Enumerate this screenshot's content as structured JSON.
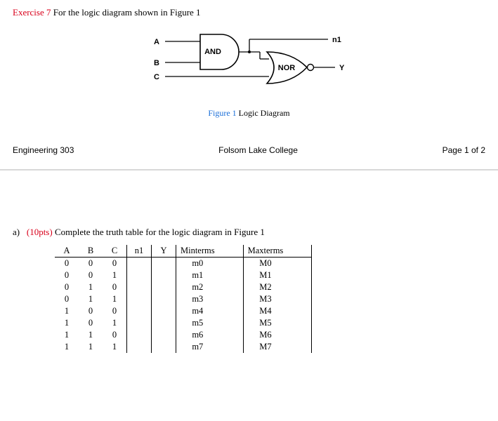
{
  "exercise": {
    "label": "Exercise 7",
    "prompt": "For the logic diagram shown in Figure 1"
  },
  "diagram": {
    "inputs": {
      "A": "A",
      "B": "B",
      "C": "C"
    },
    "gates": {
      "and": "AND",
      "nor": "NOR"
    },
    "signals": {
      "n1": "n1",
      "Y": "Y"
    },
    "caption_label": "Figure 1",
    "caption_text": "Logic Diagram"
  },
  "footer": {
    "left": "Engineering 303",
    "center": "Folsom Lake College",
    "right": "Page 1 of 2"
  },
  "partA": {
    "id": "a)",
    "pts": "(10pts)",
    "text": "Complete the truth table for the logic diagram in Figure 1"
  },
  "truth": {
    "headers": [
      "A",
      "B",
      "C",
      "n1",
      "Y",
      "Minterms",
      "",
      "Maxterms",
      ""
    ],
    "rows": [
      {
        "A": "0",
        "B": "0",
        "C": "0",
        "n1": "",
        "Y": "",
        "min": "m0",
        "minv": "",
        "max": "M0",
        "maxv": ""
      },
      {
        "A": "0",
        "B": "0",
        "C": "1",
        "n1": "",
        "Y": "",
        "min": "m1",
        "minv": "",
        "max": "M1",
        "maxv": ""
      },
      {
        "A": "0",
        "B": "1",
        "C": "0",
        "n1": "",
        "Y": "",
        "min": "m2",
        "minv": "",
        "max": "M2",
        "maxv": ""
      },
      {
        "A": "0",
        "B": "1",
        "C": "1",
        "n1": "",
        "Y": "",
        "min": "m3",
        "minv": "",
        "max": "M3",
        "maxv": ""
      },
      {
        "A": "1",
        "B": "0",
        "C": "0",
        "n1": "",
        "Y": "",
        "min": "m4",
        "minv": "",
        "max": "M4",
        "maxv": ""
      },
      {
        "A": "1",
        "B": "0",
        "C": "1",
        "n1": "",
        "Y": "",
        "min": "m5",
        "minv": "",
        "max": "M5",
        "maxv": ""
      },
      {
        "A": "1",
        "B": "1",
        "C": "0",
        "n1": "",
        "Y": "",
        "min": "m6",
        "minv": "",
        "max": "M6",
        "maxv": ""
      },
      {
        "A": "1",
        "B": "1",
        "C": "1",
        "n1": "",
        "Y": "",
        "min": "m7",
        "minv": "",
        "max": "M7",
        "maxv": ""
      }
    ]
  }
}
